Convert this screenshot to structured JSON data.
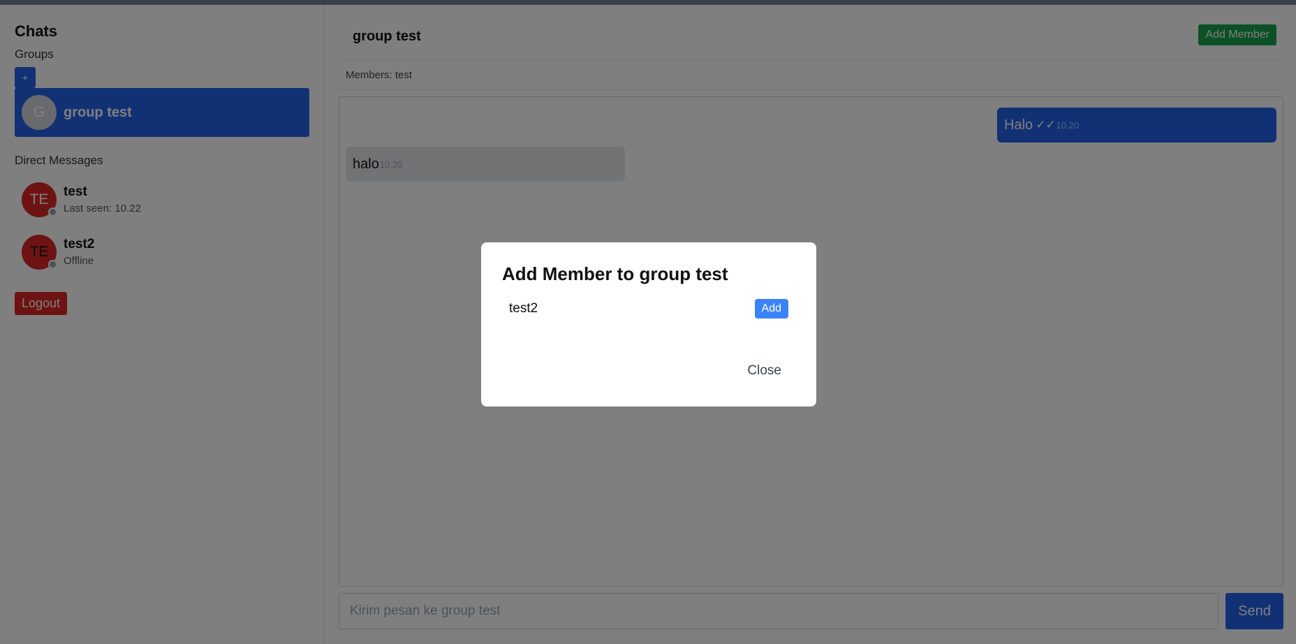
{
  "sidebar": {
    "title": "Chats",
    "groups_label": "Groups",
    "new_group_label": "+",
    "groups": [
      {
        "initial": "G",
        "name": "group test"
      }
    ],
    "dm_label": "Direct Messages",
    "dms": [
      {
        "initials": "TE",
        "name": "test",
        "status": "Last seen: 10.22"
      },
      {
        "initials": "TE",
        "name": "test2",
        "status": "Offline"
      }
    ],
    "logout_label": "Logout"
  },
  "chat": {
    "title": "group test",
    "add_member_label": "Add Member",
    "members_text": "Members: test",
    "messages": [
      {
        "text": "Halo",
        "check": "✓✓",
        "time": "10.20",
        "direction": "sent"
      },
      {
        "text": "halo",
        "time": "10.20",
        "direction": "received"
      }
    ],
    "composer_placeholder": "Kirim pesan ke group test",
    "send_label": "Send"
  },
  "modal": {
    "title": "Add Member to group test",
    "candidates": [
      {
        "name": "test2",
        "add_label": "Add"
      }
    ],
    "close_label": "Close"
  },
  "colors": {
    "primary": "#2563eb",
    "success": "#16a34a",
    "danger": "#dc2626",
    "overlay": "rgba(0,0,0,0.5)"
  }
}
